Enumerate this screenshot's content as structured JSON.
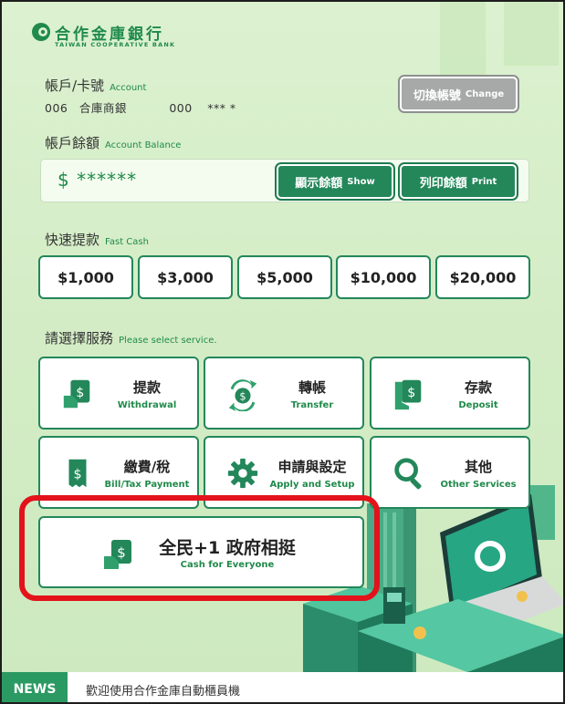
{
  "bank": {
    "name_zh": "合作金庫銀行",
    "name_en": "TAIWAN COOPERATIVE BANK",
    "logo_icon": "cooperative-bank-logo-icon"
  },
  "account": {
    "label_zh": "帳戶/卡號",
    "label_en": "Account",
    "bank_code": "006",
    "bank_name": "合庫商銀",
    "account_prefix": "000",
    "account_masked": "*** *",
    "change_label_zh": "切換帳號",
    "change_label_en": "Change"
  },
  "balance": {
    "label_zh": "帳戶餘額",
    "label_en": "Account Balance",
    "masked_value": "$ ******",
    "show_zh": "顯示餘額",
    "show_en": "Show",
    "print_zh": "列印餘額",
    "print_en": "Print"
  },
  "fast_cash": {
    "label_zh": "快速提款",
    "label_en": "Fast Cash",
    "amounts": [
      "$1,000",
      "$3,000",
      "$5,000",
      "$10,000",
      "$20,000"
    ]
  },
  "services": {
    "label_zh": "請選擇服務",
    "label_en": "Please select service.",
    "items": [
      {
        "zh": "提款",
        "en": "Withdrawal",
        "icon": "cash-withdrawal-icon"
      },
      {
        "zh": "轉帳",
        "en": "Transfer",
        "icon": "transfer-arrows-icon"
      },
      {
        "zh": "存款",
        "en": "Deposit",
        "icon": "cash-deposit-icon"
      },
      {
        "zh": "繳費/稅",
        "en": "Bill/Tax Payment",
        "icon": "receipt-icon"
      },
      {
        "zh": "申請與設定",
        "en": "Apply and Setup",
        "icon": "gear-icon"
      },
      {
        "zh": "其他",
        "en": "Other Services",
        "icon": "magnifier-icon"
      }
    ],
    "special": {
      "zh": "全民+1 政府相挺",
      "en": "Cash for Everyone",
      "icon": "cash-hand-icon"
    }
  },
  "news": {
    "tag": "NEWS",
    "text": "歡迎使用合作金庫自動櫃員機"
  },
  "colors": {
    "brand_green": "#23875a",
    "background": "#d6eec8",
    "highlight_red": "#e3121b",
    "disabled_gray": "#a7a9a9"
  }
}
